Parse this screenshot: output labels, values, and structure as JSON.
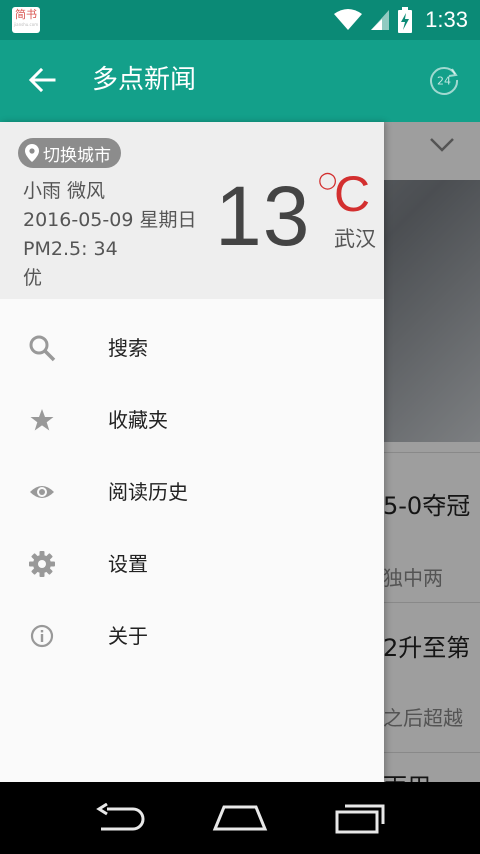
{
  "status_bar": {
    "app_badge_title": "简书",
    "app_badge_sub": "jianshu.com",
    "time": "1:33"
  },
  "toolbar": {
    "title": "多点新闻",
    "refresh_badge": "24"
  },
  "weather": {
    "switch_city_label": "切换城市",
    "condition": "小雨 微风",
    "date": "2016-05-09 星期日",
    "pm25": "PM2.5: 34",
    "air_quality": "优",
    "temperature": "13",
    "degree_symbol": "○",
    "unit": "C",
    "city": "武汉"
  },
  "menu": [
    {
      "label": "搜索",
      "icon": "search-icon"
    },
    {
      "label": "收藏夹",
      "icon": "star-icon"
    },
    {
      "label": "阅读历史",
      "icon": "eye-icon"
    },
    {
      "label": "设置",
      "icon": "gear-icon"
    },
    {
      "label": "关于",
      "icon": "info-icon"
    }
  ],
  "background_news": {
    "h1": "5-0夺冠",
    "s1": "独中两",
    "h2": "2升至第",
    "s2": "之后超越",
    "h3": "雨用"
  },
  "colors": {
    "toolbar": "#13a08a",
    "status_bar": "#0b8a76",
    "temp_unit": "#d32f2f"
  }
}
